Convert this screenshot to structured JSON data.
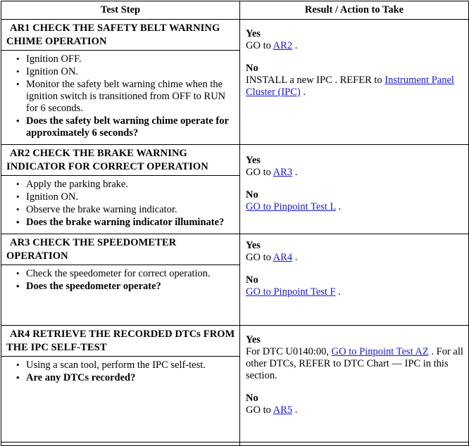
{
  "table": {
    "columns": [
      {
        "key": "test_step",
        "label": "Test Step"
      },
      {
        "key": "result_action",
        "label": "Result / Action to Take"
      }
    ],
    "link_color": "#1818d0",
    "rows": [
      {
        "id": "AR1",
        "title": "AR1 CHECK THE SAFETY BELT WARNING CHIME OPERATION",
        "title_line1": "AR1 CHECK THE SAFETY BELT WARNING",
        "title_line2": "CHIME OPERATION",
        "steps": [
          {
            "text": "Ignition OFF.",
            "bold": false
          },
          {
            "text": "Ignition ON.",
            "bold": false
          },
          {
            "text": "Monitor the safety belt warning chime when the ignition switch is transitioned from OFF to RUN for 6 seconds.",
            "bold": false
          },
          {
            "text": "Does the safety belt warning chime operate for approximately 6 seconds?",
            "bold": true
          }
        ],
        "result": {
          "yes_label": "Yes",
          "yes_prefix": "GO to ",
          "yes_link": "AR2",
          "yes_suffix": " .",
          "no_label": "No",
          "no_prefix": "INSTALL a new IPC . REFER to ",
          "no_link": "Instrument Panel Cluster (IPC)",
          "no_suffix": " ."
        }
      },
      {
        "id": "AR2",
        "title": "AR2 CHECK THE BRAKE WARNING INDICATOR FOR CORRECT OPERATION",
        "title_line1": "AR2 CHECK THE BRAKE WARNING",
        "title_line2": "INDICATOR FOR CORRECT OPERATION",
        "steps": [
          {
            "text": "Apply the parking brake.",
            "bold": false
          },
          {
            "text": "Ignition ON.",
            "bold": false
          },
          {
            "text": "Observe the brake warning indicator.",
            "bold": false
          },
          {
            "text": "Does the brake warning indicator illuminate?",
            "bold": true
          }
        ],
        "result": {
          "yes_label": "Yes",
          "yes_prefix": "GO to ",
          "yes_link": "AR3",
          "yes_suffix": " .",
          "no_label": "No",
          "no_prefix": "",
          "no_link": "GO to Pinpoint Test L",
          "no_suffix": " ."
        }
      },
      {
        "id": "AR3",
        "title": "AR3 CHECK THE SPEEDOMETER OPERATION",
        "title_line1": "AR3 CHECK THE SPEEDOMETER OPERATION",
        "title_line2": "",
        "steps": [
          {
            "text": "Check the speedometer for correct operation.",
            "bold": false
          },
          {
            "text": "Does the speedometer operate?",
            "bold": true
          }
        ],
        "result": {
          "yes_label": "Yes",
          "yes_prefix": "GO to ",
          "yes_link": "AR4",
          "yes_suffix": " .",
          "no_label": "No",
          "no_prefix": "",
          "no_link": "GO to Pinpoint Test F",
          "no_suffix": " ."
        }
      },
      {
        "id": "AR4",
        "title": "AR4 RETRIEVE THE RECORDED DTCs FROM THE IPC SELF-TEST",
        "title_line1": "AR4 RETRIEVE THE RECORDED DTCs FROM",
        "title_line2": "THE IPC SELF-TEST",
        "steps": [
          {
            "text": "Using a scan tool, perform the IPC self-test.",
            "bold": false
          },
          {
            "text": "Are any DTCs recorded?",
            "bold": true
          }
        ],
        "result": {
          "yes_label": "Yes",
          "yes_prefix": "For DTC U0140:00, ",
          "yes_link": "GO to Pinpoint Test AZ",
          "yes_suffix": " . For all other DTCs, REFER to DTC Chart — IPC in this section.",
          "no_label": "No",
          "no_prefix": "GO to ",
          "no_link": "AR5",
          "no_suffix": " ."
        }
      }
    ]
  }
}
